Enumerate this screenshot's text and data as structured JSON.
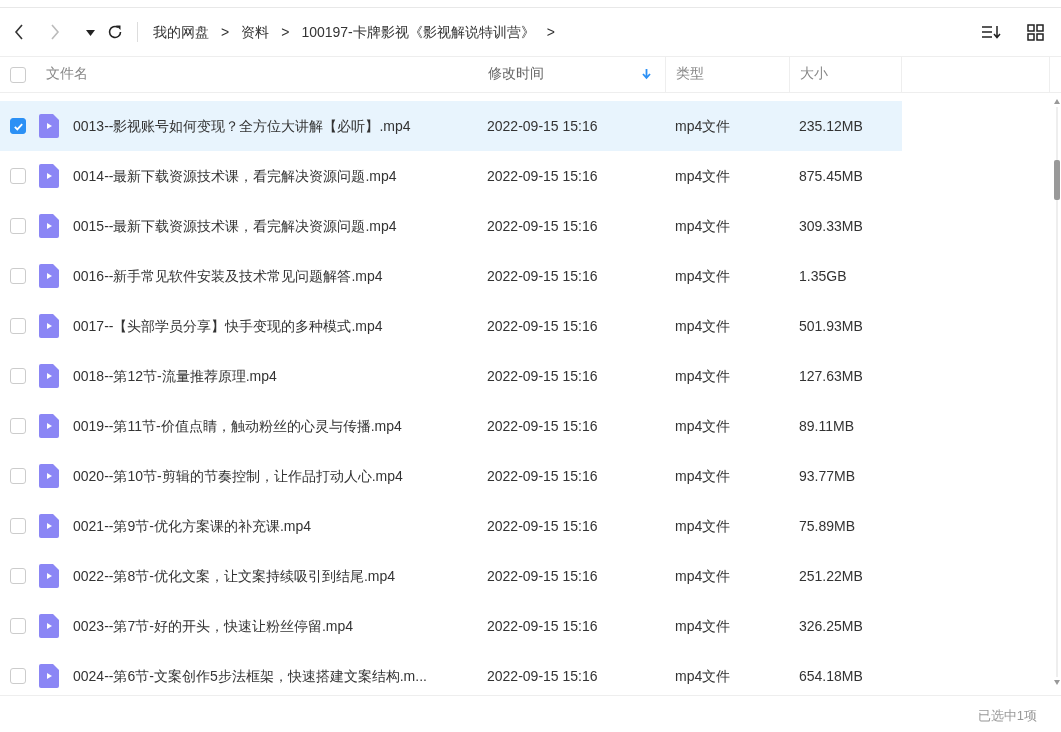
{
  "toolbar": {
    "back_disabled": false,
    "forward_disabled": true,
    "breadcrumb": [
      "我的网盘",
      "资料",
      "100197-卡牌影视《影视解说特训营》"
    ],
    "separator": ">",
    "trailing": ">"
  },
  "table": {
    "all_checked": false,
    "columns": [
      {
        "label": "文件名",
        "sorted": false
      },
      {
        "label": "修改时间",
        "sorted": true
      },
      {
        "label": "类型",
        "sorted": false
      },
      {
        "label": "大小",
        "sorted": false
      }
    ],
    "rows": [
      {
        "name": "0013--影视账号如何变现？全方位大讲解【必听】.mp4",
        "modified": "2022-09-15 15:16",
        "type": "mp4文件",
        "size": "235.12MB",
        "selected": true
      },
      {
        "name": "0014--最新下载资源技术课，看完解决资源问题.mp4",
        "modified": "2022-09-15 15:16",
        "type": "mp4文件",
        "size": "875.45MB",
        "selected": false
      },
      {
        "name": "0015--最新下载资源技术课，看完解决资源问题.mp4",
        "modified": "2022-09-15 15:16",
        "type": "mp4文件",
        "size": "309.33MB",
        "selected": false
      },
      {
        "name": "0016--新手常见软件安装及技术常见问题解答.mp4",
        "modified": "2022-09-15 15:16",
        "type": "mp4文件",
        "size": "1.35GB",
        "selected": false
      },
      {
        "name": "0017--【头部学员分享】快手变现的多种模式.mp4",
        "modified": "2022-09-15 15:16",
        "type": "mp4文件",
        "size": "501.93MB",
        "selected": false
      },
      {
        "name": "0018--第12节-流量推荐原理.mp4",
        "modified": "2022-09-15 15:16",
        "type": "mp4文件",
        "size": "127.63MB",
        "selected": false
      },
      {
        "name": "0019--第11节-价值点睛，触动粉丝的心灵与传播.mp4",
        "modified": "2022-09-15 15:16",
        "type": "mp4文件",
        "size": "89.11MB",
        "selected": false
      },
      {
        "name": "0020--第10节-剪辑的节奏控制，让作品打动人心.mp4",
        "modified": "2022-09-15 15:16",
        "type": "mp4文件",
        "size": "93.77MB",
        "selected": false
      },
      {
        "name": "0021--第9节-优化方案课的补充课.mp4",
        "modified": "2022-09-15 15:16",
        "type": "mp4文件",
        "size": "75.89MB",
        "selected": false
      },
      {
        "name": "0022--第8节-优化文案，让文案持续吸引到结尾.mp4",
        "modified": "2022-09-15 15:16",
        "type": "mp4文件",
        "size": "251.22MB",
        "selected": false
      },
      {
        "name": "0023--第7节-好的开头，快速让粉丝停留.mp4",
        "modified": "2022-09-15 15:16",
        "type": "mp4文件",
        "size": "326.25MB",
        "selected": false
      },
      {
        "name": "0024--第6节-文案创作5步法框架，快速搭建文案结构.m...",
        "modified": "2022-09-15 15:16",
        "type": "mp4文件",
        "size": "654.18MB",
        "selected": false
      }
    ]
  },
  "status_bar": "已选中1项"
}
